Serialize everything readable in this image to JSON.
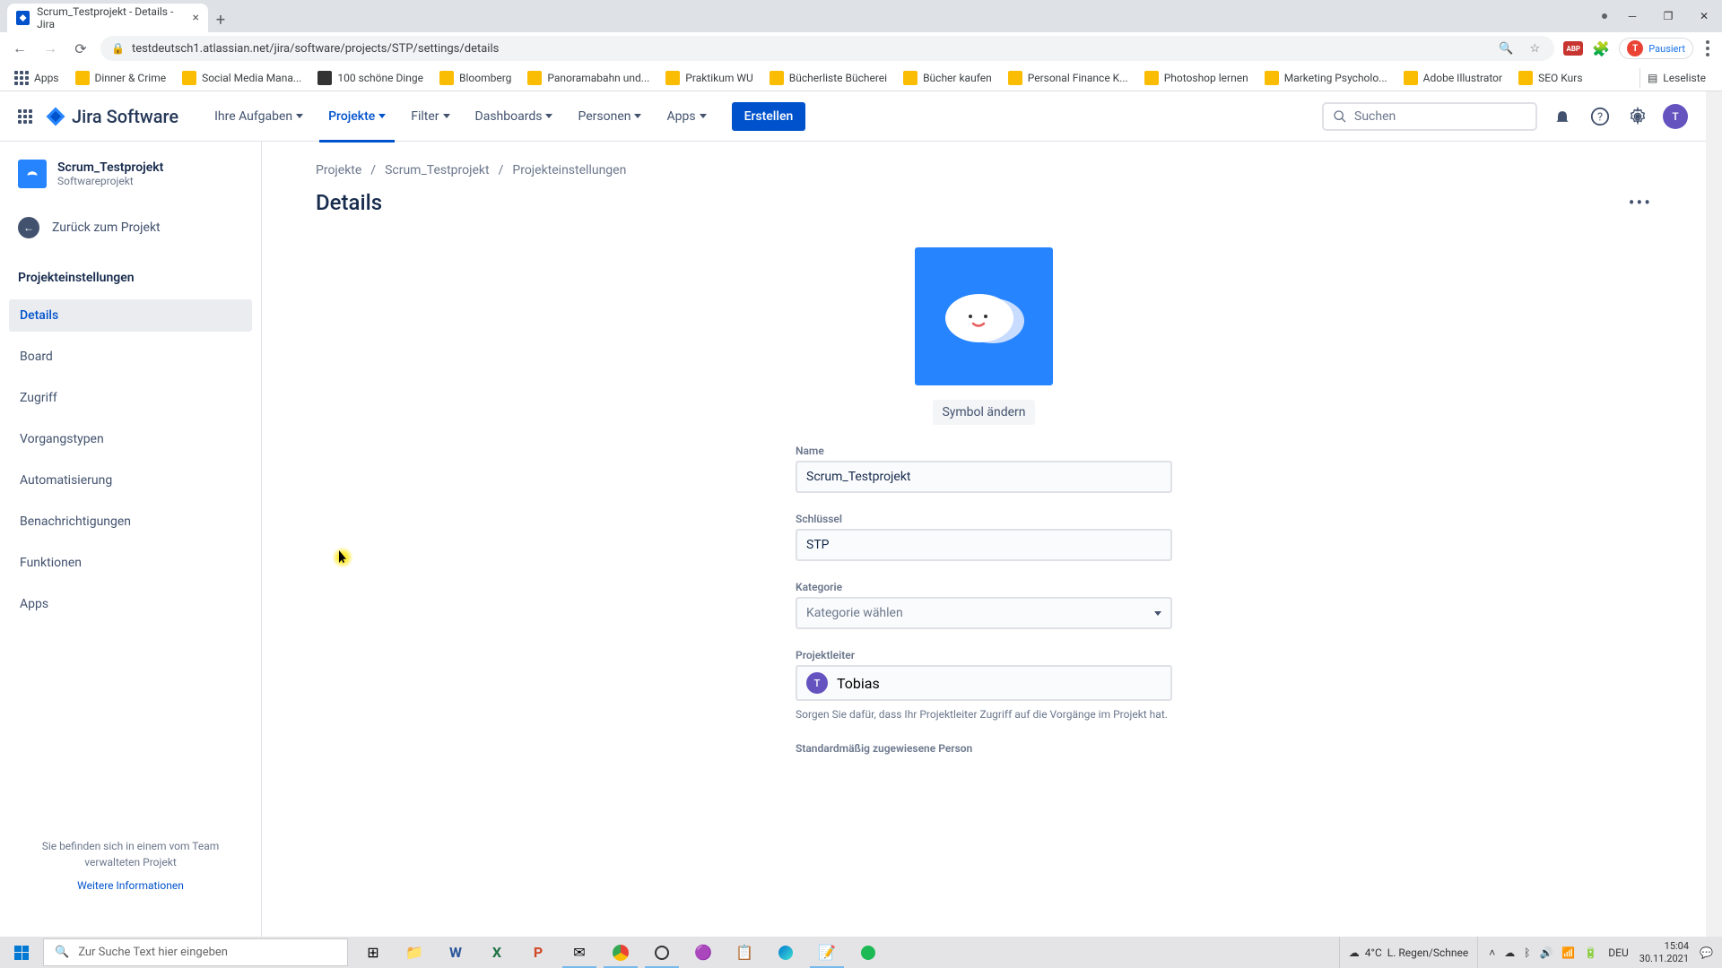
{
  "browser": {
    "tab_title": "Scrum_Testprojekt - Details - Jira",
    "url": "testdeutsch1.atlassian.net/jira/software/projects/STP/settings/details",
    "profile_status": "Pausiert",
    "apps_label": "Apps",
    "bookmarks": [
      "Dinner & Crime",
      "Social Media Mana...",
      "100 schöne Dinge",
      "Bloomberg",
      "Panoramabahn und...",
      "Praktikum WU",
      "Bücherliste Bücherei",
      "Bücher kaufen",
      "Personal Finance K...",
      "Photoshop lernen",
      "Marketing Psycholo...",
      "Adobe Illustrator",
      "SEO Kurs"
    ],
    "reading_list": "Leseliste"
  },
  "jira": {
    "brand": "Jira Software",
    "nav": {
      "tasks": "Ihre Aufgaben",
      "projects": "Projekte",
      "filters": "Filter",
      "dashboards": "Dashboards",
      "people": "Personen",
      "apps": "Apps"
    },
    "create": "Erstellen",
    "search_placeholder": "Suchen",
    "user_initial": "T"
  },
  "sidebar": {
    "project_name": "Scrum_Testprojekt",
    "project_type": "Softwareprojekt",
    "back": "Zurück zum Projekt",
    "heading": "Projekteinstellungen",
    "items": {
      "details": "Details",
      "board": "Board",
      "access": "Zugriff",
      "issue_types": "Vorgangstypen",
      "automation": "Automatisierung",
      "notifications": "Benachrichtigungen",
      "features": "Funktionen",
      "apps": "Apps"
    },
    "footer_text": "Sie befinden sich in einem vom Team verwalteten Projekt",
    "footer_link": "Weitere Informationen"
  },
  "breadcrumb": {
    "a": "Projekte",
    "b": "Scrum_Testprojekt",
    "c": "Projekteinstellungen"
  },
  "page": {
    "title": "Details",
    "change_icon": "Symbol ändern",
    "name_label": "Name",
    "name_value": "Scrum_Testprojekt",
    "key_label": "Schlüssel",
    "key_value": "STP",
    "category_label": "Kategorie",
    "category_placeholder": "Kategorie wählen",
    "lead_label": "Projektleiter",
    "lead_name": "Tobias",
    "lead_initial": "T",
    "lead_hint": "Sorgen Sie dafür, dass Ihr Projektleiter Zugriff auf die Vorgänge im Projekt hat.",
    "assignee_label": "Standardmäßig zugewiesene Person"
  },
  "taskbar": {
    "search_placeholder": "Zur Suche Text hier eingeben",
    "weather_temp": "4°C",
    "weather_desc": "L. Regen/Schnee",
    "lang": "DEU",
    "time": "15:04",
    "date": "30.11.2021"
  }
}
